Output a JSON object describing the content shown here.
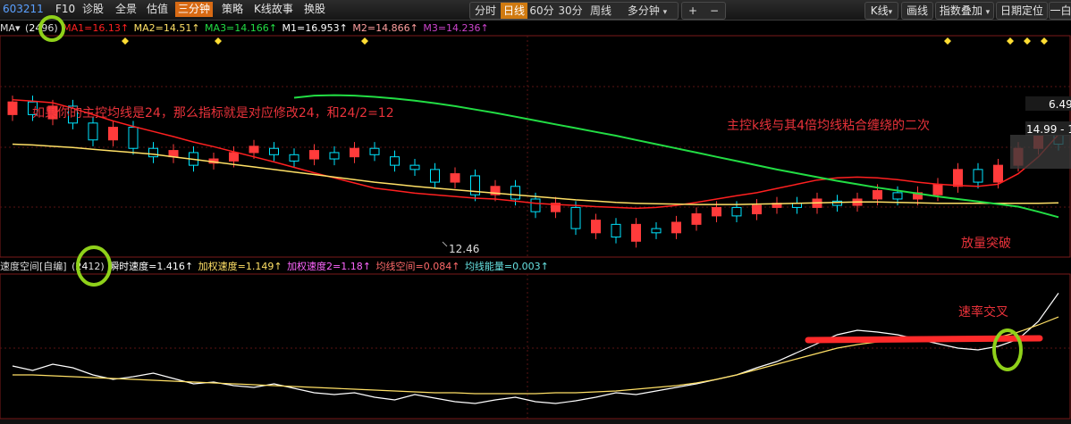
{
  "toolbar": {
    "stock_code": "603211",
    "left_items": [
      "F10",
      "诊股",
      "全景",
      "估值",
      "三分钟",
      "策略",
      "K线故事",
      "换股"
    ],
    "active_item": "三分钟",
    "period_tabs": [
      "分时",
      "日线",
      "60分",
      "30分",
      "周线",
      "多分钟"
    ],
    "active_period": "日线",
    "plus_label": "+",
    "minus_label": "−",
    "kline_label": "K线",
    "draw_label": "画线",
    "index_overlay_label": "指数叠加",
    "date_locate_label": "日期定位",
    "extra_label": "一白",
    "caret": "▾"
  },
  "ma_bar": {
    "name": "MA▾",
    "params_open": "(",
    "param1": "24",
    "params_rest": "96)",
    "ma1": "MA1=16.13↑",
    "ma2": "MA2=14.51↑",
    "ma3": "MA3=14.166↑",
    "m1": "M1=16.953↑",
    "m2": "M2=14.866↑",
    "m3": "M3=14.236↑"
  },
  "indicator_bar": {
    "name": "速度空间[自编]",
    "params_open": "(",
    "param1": "24",
    "params_rest": "12)",
    "v1": "瞬时速度=1.416↑",
    "v2": "加权速度=1.149↑",
    "v3": "加权速度2=1.18↑",
    "v4": "均线空间=0.084↑",
    "v5": "均线能量=0.003↑"
  },
  "annotations": {
    "note1": "如果你的主控均线是24，那么指标就是对应修改24，和24/2=12",
    "note2": "主控k线与其4倍均线粘合缠绕的二次",
    "note3": "放量突破",
    "note4": "速率交叉"
  },
  "chart_labels": {
    "low_price": "12.46",
    "high_price": "6.49",
    "range_label": "14.99 - 1"
  },
  "colors": {
    "up": "#ff3b3b",
    "down": "#00e5ff",
    "ma1": "#ff2020",
    "ma2": "#ffe066",
    "ma3": "#22dd44",
    "m1": "#ffffff",
    "m2": "#ff9f9f",
    "m3": "#cc44cc",
    "annotation": "#e8323a",
    "highlight_circle": "#8fd11a",
    "active_tab": "#d86a14"
  },
  "chart_data": {
    "type": "candlestick",
    "series": [
      {
        "name": "MA1",
        "values": [
          16.95,
          16.92,
          16.88,
          16.75,
          16.6,
          16.45,
          16.32,
          16.2,
          16.08,
          15.95,
          15.84,
          15.72,
          15.6,
          15.48,
          15.35,
          15.22,
          15.1,
          14.98,
          14.86,
          14.8,
          14.74,
          14.7,
          14.66,
          14.62,
          14.6,
          14.55,
          14.5,
          14.47,
          14.45,
          14.42,
          14.4,
          14.38,
          14.4,
          14.45,
          14.52,
          14.6,
          14.68,
          14.75,
          14.85,
          14.95,
          15.05,
          15.1,
          15.12,
          15.1,
          15.06,
          15.0,
          14.95,
          14.92,
          14.9,
          14.95,
          15.2,
          15.6,
          16.13
        ]
      },
      {
        "name": "MA2",
        "values": [
          15.9,
          15.88,
          15.85,
          15.82,
          15.78,
          15.74,
          15.7,
          15.66,
          15.6,
          15.54,
          15.48,
          15.42,
          15.36,
          15.3,
          15.24,
          15.18,
          15.12,
          15.06,
          15.0,
          14.95,
          14.9,
          14.86,
          14.82,
          14.78,
          14.74,
          14.7,
          14.66,
          14.62,
          14.58,
          14.55,
          14.52,
          14.5,
          14.49,
          14.48,
          14.47,
          14.47,
          14.47,
          14.48,
          14.49,
          14.5,
          14.51,
          14.52,
          14.53,
          14.53,
          14.52,
          14.51,
          14.5,
          14.5,
          14.5,
          14.5,
          14.5,
          14.5,
          14.51
        ]
      },
      {
        "name": "MA3",
        "values": [
          null,
          null,
          null,
          null,
          null,
          null,
          null,
          null,
          null,
          null,
          null,
          null,
          null,
          null,
          17.0,
          17.05,
          17.06,
          17.05,
          17.02,
          16.98,
          16.93,
          16.87,
          16.8,
          16.72,
          16.64,
          16.55,
          16.46,
          16.37,
          16.28,
          16.19,
          16.1,
          16.0,
          15.9,
          15.8,
          15.7,
          15.6,
          15.5,
          15.4,
          15.3,
          15.21,
          15.12,
          15.03,
          14.95,
          14.87,
          14.8,
          14.73,
          14.66,
          14.6,
          14.54,
          14.48,
          14.42,
          14.3,
          14.17
        ]
      }
    ],
    "candles": [
      {
        "o": 16.6,
        "c": 16.9
      },
      {
        "o": 16.9,
        "c": 16.6
      },
      {
        "o": 16.5,
        "c": 16.8
      },
      {
        "o": 16.8,
        "c": 16.4
      },
      {
        "o": 16.4,
        "c": 16.0
      },
      {
        "o": 16.0,
        "c": 16.3
      },
      {
        "o": 16.3,
        "c": 15.8
      },
      {
        "o": 15.8,
        "c": 15.6
      },
      {
        "o": 15.6,
        "c": 15.75
      },
      {
        "o": 15.7,
        "c": 15.4
      },
      {
        "o": 15.45,
        "c": 15.55
      },
      {
        "o": 15.5,
        "c": 15.7
      },
      {
        "o": 15.7,
        "c": 15.85
      },
      {
        "o": 15.8,
        "c": 15.65
      },
      {
        "o": 15.65,
        "c": 15.5
      },
      {
        "o": 15.55,
        "c": 15.75
      },
      {
        "o": 15.7,
        "c": 15.55
      },
      {
        "o": 15.6,
        "c": 15.8
      },
      {
        "o": 15.8,
        "c": 15.65
      },
      {
        "o": 15.6,
        "c": 15.4
      },
      {
        "o": 15.4,
        "c": 15.3
      },
      {
        "o": 15.3,
        "c": 15.0
      },
      {
        "o": 15.0,
        "c": 15.2
      },
      {
        "o": 15.15,
        "c": 14.7
      },
      {
        "o": 14.7,
        "c": 14.9
      },
      {
        "o": 14.9,
        "c": 14.6
      },
      {
        "o": 14.6,
        "c": 14.3
      },
      {
        "o": 14.3,
        "c": 14.5
      },
      {
        "o": 14.4,
        "c": 13.9
      },
      {
        "o": 13.8,
        "c": 14.1
      },
      {
        "o": 14.0,
        "c": 13.7
      },
      {
        "o": 13.6,
        "c": 14.0
      },
      {
        "o": 13.9,
        "c": 13.8
      },
      {
        "o": 13.8,
        "c": 14.05
      },
      {
        "o": 14.0,
        "c": 14.25
      },
      {
        "o": 14.2,
        "c": 14.4
      },
      {
        "o": 14.4,
        "c": 14.2
      },
      {
        "o": 14.25,
        "c": 14.45
      },
      {
        "o": 14.4,
        "c": 14.5
      },
      {
        "o": 14.5,
        "c": 14.4
      },
      {
        "o": 14.4,
        "c": 14.6
      },
      {
        "o": 14.55,
        "c": 14.45
      },
      {
        "o": 14.45,
        "c": 14.6
      },
      {
        "o": 14.6,
        "c": 14.8
      },
      {
        "o": 14.75,
        "c": 14.6
      },
      {
        "o": 14.6,
        "c": 14.75
      },
      {
        "o": 14.7,
        "c": 14.95
      },
      {
        "o": 14.9,
        "c": 15.3
      },
      {
        "o": 15.3,
        "c": 15.0
      },
      {
        "o": 15.0,
        "c": 15.4
      },
      {
        "o": 15.4,
        "c": 15.8
      },
      {
        "o": 15.8,
        "c": 16.2
      },
      {
        "o": 16.2,
        "c": 15.9
      }
    ],
    "indicator": {
      "name": "速度空间",
      "series": [
        {
          "name": "瞬时速度",
          "values": [
            0.6,
            0.55,
            0.62,
            0.58,
            0.5,
            0.45,
            0.48,
            0.52,
            0.46,
            0.4,
            0.42,
            0.38,
            0.36,
            0.4,
            0.35,
            0.3,
            0.28,
            0.3,
            0.25,
            0.22,
            0.28,
            0.24,
            0.2,
            0.18,
            0.22,
            0.25,
            0.2,
            0.18,
            0.21,
            0.25,
            0.3,
            0.28,
            0.32,
            0.36,
            0.4,
            0.45,
            0.5,
            0.58,
            0.65,
            0.75,
            0.85,
            0.95,
            1.0,
            0.98,
            0.95,
            0.9,
            0.85,
            0.8,
            0.78,
            0.82,
            0.9,
            1.1,
            1.416
          ]
        },
        {
          "name": "加权速度",
          "values": [
            0.5,
            0.5,
            0.49,
            0.48,
            0.47,
            0.46,
            0.45,
            0.44,
            0.43,
            0.42,
            0.41,
            0.4,
            0.39,
            0.38,
            0.37,
            0.36,
            0.35,
            0.34,
            0.33,
            0.32,
            0.31,
            0.3,
            0.3,
            0.29,
            0.29,
            0.29,
            0.29,
            0.3,
            0.3,
            0.31,
            0.32,
            0.34,
            0.36,
            0.38,
            0.41,
            0.45,
            0.5,
            0.56,
            0.62,
            0.68,
            0.74,
            0.8,
            0.84,
            0.87,
            0.88,
            0.88,
            0.88,
            0.88,
            0.89,
            0.92,
            0.98,
            1.06,
            1.149
          ]
        }
      ]
    }
  }
}
